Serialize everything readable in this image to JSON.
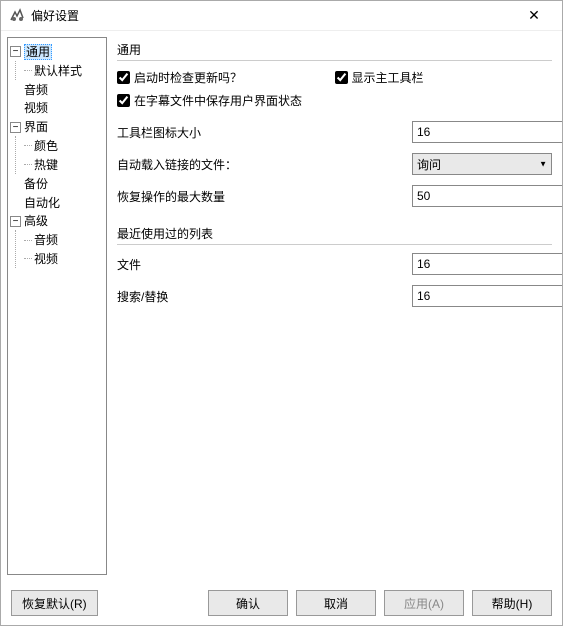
{
  "window": {
    "title": "偏好设置"
  },
  "tree": {
    "general": "通用",
    "default_style": "默认样式",
    "audio": "音频",
    "video": "视频",
    "interface": "界面",
    "color": "颜色",
    "hotkey": "热键",
    "backup": "备份",
    "automation": "自动化",
    "advanced": "高级",
    "adv_audio": "音频",
    "adv_video": "视频"
  },
  "general": {
    "section_title": "通用",
    "check_update": "启动时检查更新吗？",
    "show_toolbar": "显示主工具栏",
    "save_ui_state": "在字幕文件中保存用户界面状态",
    "toolbar_icon_size_label": "工具栏图标大小",
    "toolbar_icon_size_value": "16",
    "auto_load_linked_label": "自动载入链接的文件：",
    "auto_load_linked_value": "询问",
    "undo_max_label": "恢复操作的最大数量",
    "undo_max_value": "50"
  },
  "recent": {
    "section_title": "最近使用过的列表",
    "files_label": "文件",
    "files_value": "16",
    "search_label": "搜索/替换",
    "search_value": "16"
  },
  "buttons": {
    "restore_defaults": "恢复默认(R)",
    "ok": "确认",
    "cancel": "取消",
    "apply": "应用(A)",
    "help": "帮助(H)"
  }
}
